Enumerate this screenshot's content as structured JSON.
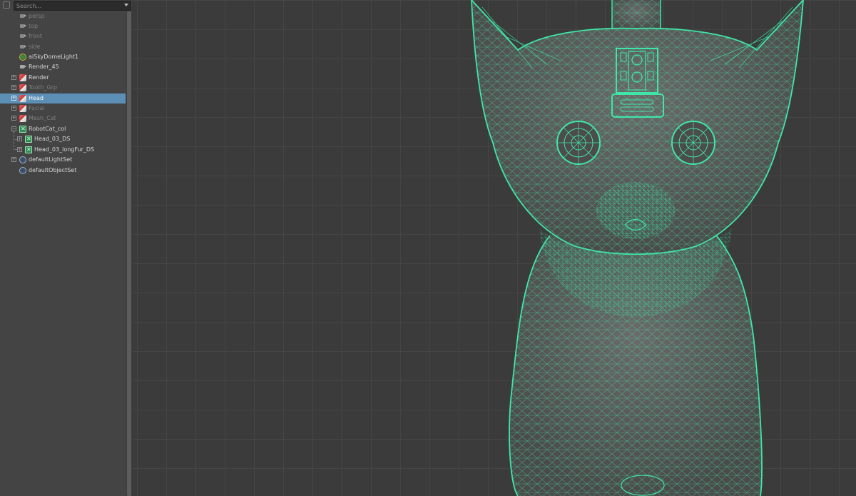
{
  "outliner": {
    "search_placeholder": "Search...",
    "items": [
      {
        "label": "persp",
        "icon": "camera-icon",
        "state": "dim"
      },
      {
        "label": "top",
        "icon": "camera-icon",
        "state": "dim"
      },
      {
        "label": "front",
        "icon": "camera-icon",
        "state": "dim"
      },
      {
        "label": "side",
        "icon": "camera-icon",
        "state": "dim"
      },
      {
        "label": "aiSkyDomeLight1",
        "icon": "light-icon",
        "state": "normal"
      },
      {
        "label": "Render_45",
        "icon": "camera-icon",
        "state": "normal"
      },
      {
        "label": "Render",
        "icon": "group-icon",
        "state": "normal"
      },
      {
        "label": "Tooth_Grp",
        "icon": "group-icon",
        "state": "dim"
      },
      {
        "label": "Head",
        "icon": "group-icon",
        "state": "selected"
      },
      {
        "label": "Facial",
        "icon": "group-icon",
        "state": "dim"
      },
      {
        "label": "Mesh_Cat",
        "icon": "group-icon",
        "state": "dim"
      },
      {
        "label": "RobotCat_col",
        "icon": "mesh-icon",
        "state": "normal"
      },
      {
        "label": "Head_03_DS",
        "icon": "mesh-icon",
        "state": "normal"
      },
      {
        "label": "Head_03_longFur_DS",
        "icon": "mesh-icon",
        "state": "normal"
      },
      {
        "label": "defaultLightSet",
        "icon": "set-icon",
        "state": "normal"
      },
      {
        "label": "defaultObjectSet",
        "icon": "set-icon",
        "state": "normal"
      }
    ]
  },
  "viewport": {
    "background": "#3b3b3b",
    "wireframe_color": "#3fe6a8",
    "mesh_shade": "#5a5a5a",
    "subject": "cat-wireframe-model"
  }
}
